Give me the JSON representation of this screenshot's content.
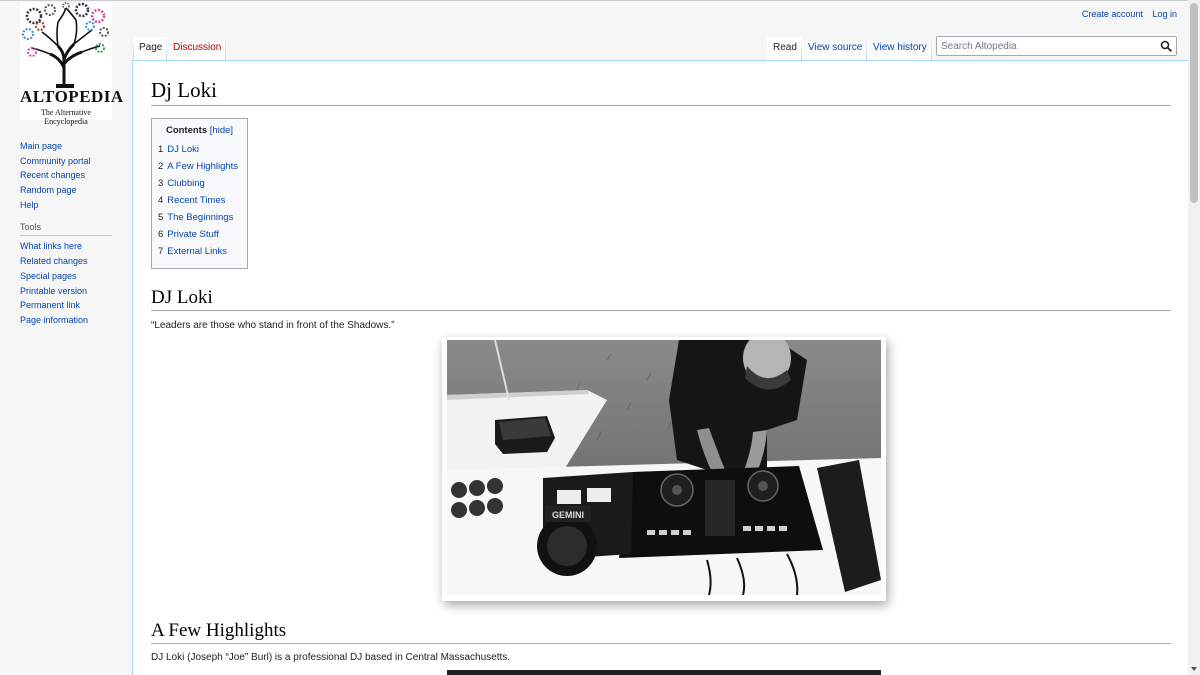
{
  "logo": {
    "wordmark": "ALTOPEDIA",
    "tagline": "The Alternative Encyclopedia"
  },
  "personal_tools": {
    "create_account": "Create account",
    "login": "Log in"
  },
  "tabs": {
    "page": "Page",
    "discussion": "Discussion",
    "read": "Read",
    "view_source": "View source",
    "view_history": "View history"
  },
  "search": {
    "placeholder": "Search Altopedia",
    "icon": "magnifier-icon"
  },
  "navigation": {
    "items": [
      "Main page",
      "Community portal",
      "Recent changes",
      "Random page",
      "Help"
    ]
  },
  "tools": {
    "heading": "Tools",
    "items": [
      "What links here",
      "Related changes",
      "Special pages",
      "Printable version",
      "Permanent link",
      "Page information"
    ]
  },
  "page": {
    "title": "Dj Loki",
    "toc": {
      "title": "Contents",
      "toggle": "[hide]",
      "items": [
        {
          "num": "1",
          "label": "DJ Loki"
        },
        {
          "num": "2",
          "label": "A Few Highlights"
        },
        {
          "num": "3",
          "label": "Clubbing"
        },
        {
          "num": "4",
          "label": "Recent Times"
        },
        {
          "num": "5",
          "label": "The Beginnings"
        },
        {
          "num": "6",
          "label": "Private Stuff"
        },
        {
          "num": "7",
          "label": "External Links"
        }
      ]
    },
    "sections": {
      "dj_loki": {
        "heading": "DJ Loki",
        "quote": "“Leaders are those who stand in front of the Shadows.”"
      },
      "highlights": {
        "heading": "A Few Highlights",
        "text": "DJ Loki (Joseph “Joe” Burl) is a professional DJ based in Central Massachusetts."
      }
    }
  },
  "colors": {
    "link": "#0645ad",
    "new_link": "#ba0000",
    "border": "#a7d7f9"
  }
}
